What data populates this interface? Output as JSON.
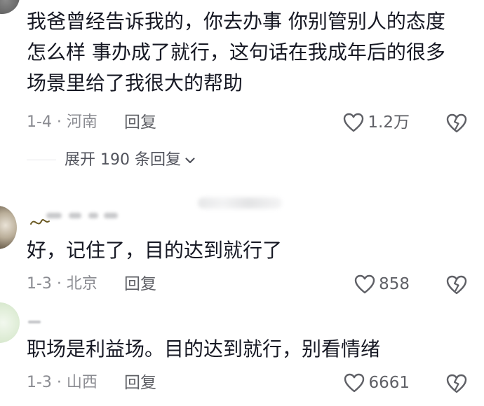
{
  "comments": [
    {
      "text": "我爸曾经告诉我的，你去办事 你别管别人的态度\n怎么样 事办成了就行，这句话在我成年后的很多\n场景里给了我很大的帮助",
      "date": "1-4 · 河南",
      "reply_label": "回复",
      "likes": "1.2万"
    },
    {
      "text": "好，记住了，目的达到就行了",
      "date": "1-3 · 北京",
      "reply_label": "回复",
      "likes": "858"
    },
    {
      "text": "职场是利益场。目的达到就行，别看情绪",
      "date": "1-3 · 山西",
      "reply_label": "回复",
      "likes": "6661"
    }
  ],
  "expand_replies": {
    "label": "展开 190 条回复",
    "icon": "chevron-down-icon"
  },
  "icons": {
    "like": "heart-outline-icon",
    "dislike": "broken-heart-icon"
  },
  "colors": {
    "text": "#161823",
    "meta": "#8a8b91",
    "action": "#5f6066"
  }
}
